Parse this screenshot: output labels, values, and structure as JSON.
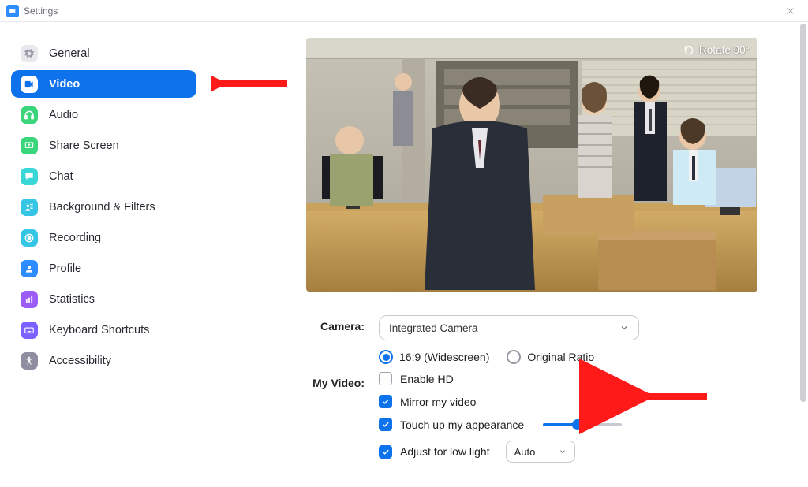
{
  "window": {
    "title": "Settings"
  },
  "sidebar": {
    "items": [
      {
        "label": "General"
      },
      {
        "label": "Video"
      },
      {
        "label": "Audio"
      },
      {
        "label": "Share Screen"
      },
      {
        "label": "Chat"
      },
      {
        "label": "Background & Filters"
      },
      {
        "label": "Recording"
      },
      {
        "label": "Profile"
      },
      {
        "label": "Statistics"
      },
      {
        "label": "Keyboard Shortcuts"
      },
      {
        "label": "Accessibility"
      }
    ],
    "active_index": 1
  },
  "preview": {
    "rotate_label": "Rotate 90°"
  },
  "camera": {
    "label": "Camera:",
    "selected": "Integrated Camera",
    "aspect": {
      "wide_label": "16:9 (Widescreen)",
      "orig_label": "Original Ratio",
      "selected": "wide"
    }
  },
  "my_video": {
    "label": "My Video:",
    "enable_hd": {
      "label": "Enable HD",
      "checked": false
    },
    "mirror": {
      "label": "Mirror my video",
      "checked": true
    },
    "touch_up": {
      "label": "Touch up my appearance",
      "checked": true,
      "slider_pct": 44
    },
    "low_light": {
      "label": "Adjust for low light",
      "checked": true,
      "mode": "Auto"
    }
  }
}
